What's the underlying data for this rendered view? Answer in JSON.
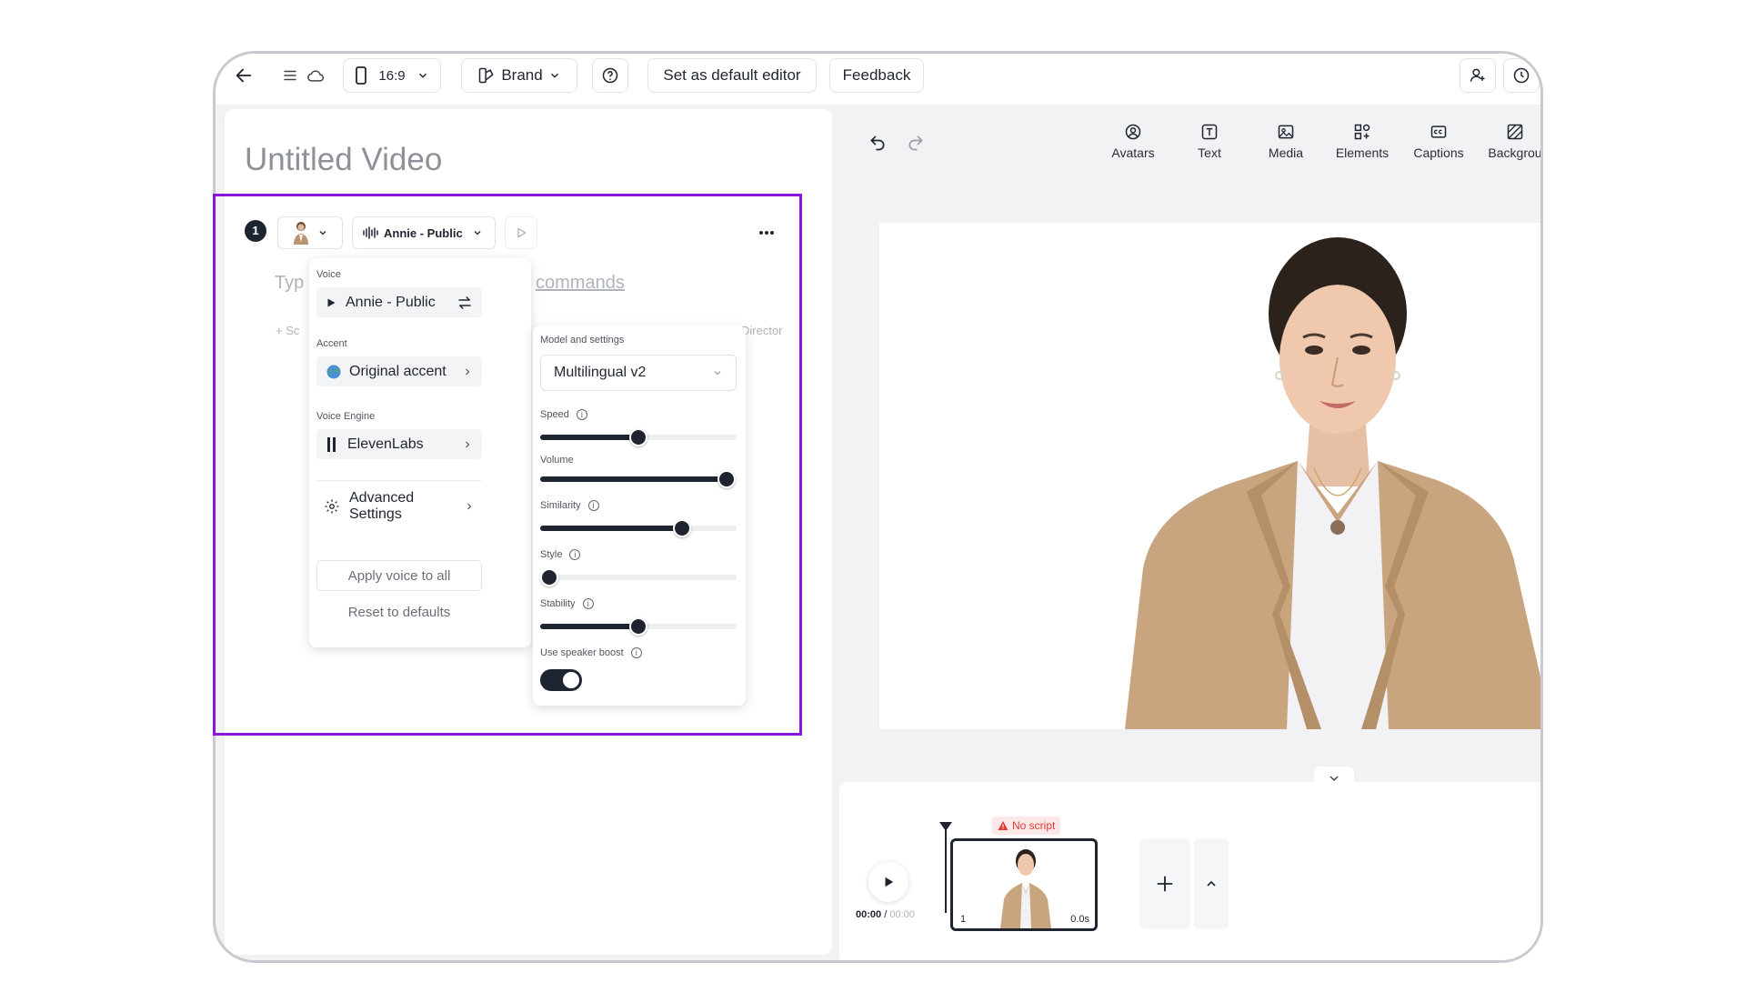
{
  "topbar": {
    "aspect_ratio": "16:9",
    "brand_label": "Brand",
    "default_editor_label": "Set as default editor",
    "feedback_label": "Feedback"
  },
  "editor": {
    "title": "Untitled Video",
    "scene_number": "1",
    "voice_button": "Annie - Public",
    "script_placeholder_start": "Typ",
    "script_placeholder_end": "commands",
    "add_scene_label": "+ Sc",
    "director_label": "Director"
  },
  "voice_popup": {
    "voice_label": "Voice",
    "voice_value": "Annie - Public",
    "accent_label": "Accent",
    "accent_value": "Original accent",
    "engine_label": "Voice Engine",
    "engine_value": "ElevenLabs",
    "advanced_label": "Advanced Settings",
    "apply_label": "Apply voice to all",
    "reset_label": "Reset to defaults"
  },
  "model_popup": {
    "title": "Model and settings",
    "model_value": "Multilingual v2",
    "speed_label": "Speed",
    "speed_value": 0.5,
    "volume_label": "Volume",
    "volume_value": 0.95,
    "similarity_label": "Similarity",
    "similarity_value": 0.72,
    "style_label": "Style",
    "style_value": 0.0,
    "stability_label": "Stability",
    "stability_value": 0.5,
    "speaker_boost_label": "Use speaker boost",
    "speaker_boost_on": true
  },
  "toolbar_tools": [
    {
      "label": "Avatars",
      "icon": "avatar-icon"
    },
    {
      "label": "Text",
      "icon": "text-icon"
    },
    {
      "label": "Media",
      "icon": "media-icon"
    },
    {
      "label": "Elements",
      "icon": "elements-icon"
    },
    {
      "label": "Captions",
      "icon": "captions-icon"
    },
    {
      "label": "Backgrou",
      "icon": "background-icon"
    }
  ],
  "timeline": {
    "current_time": "00:00",
    "total_time": "00:00",
    "warning_text": "No script",
    "scene_index": "1",
    "scene_duration": "0.0s"
  },
  "colors": {
    "highlight": "#8a14d8",
    "accent_dark": "#1e2430",
    "warning": "#e03a3a"
  }
}
